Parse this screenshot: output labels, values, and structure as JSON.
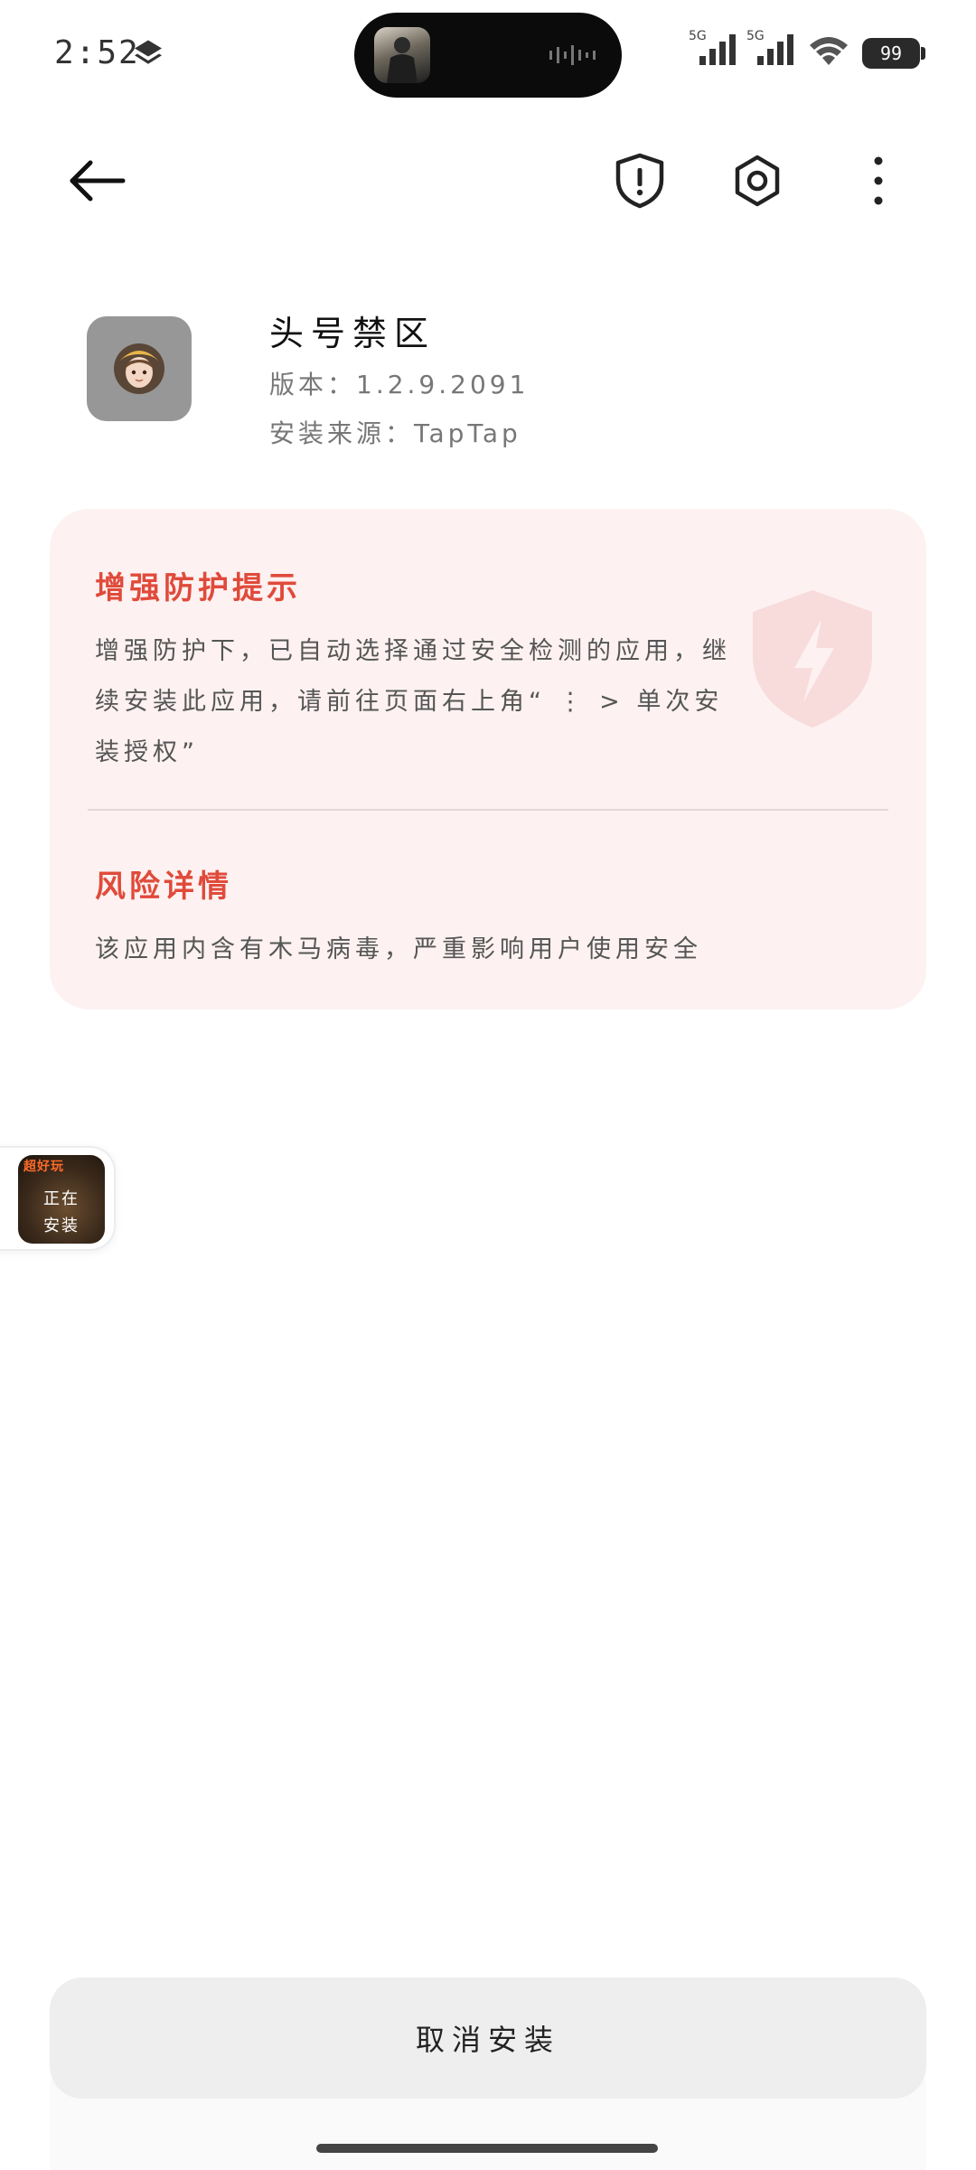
{
  "status_bar": {
    "time": "2:52",
    "network_1": "5G",
    "network_2": "5G",
    "battery": "99"
  },
  "header": {
    "icons": [
      "back-arrow-icon",
      "shield-alert-icon",
      "settings-icon",
      "more-vertical-icon"
    ]
  },
  "app": {
    "name": "头号禁区",
    "version": "版本：1.2.9.2091",
    "source": "安装来源：TapTap"
  },
  "warning_card": {
    "title": "增强防护提示",
    "text": "增强防护下，已自动选择通过安全检测的应用，继续安装此应用，请前往页面右上角“ ⋮ > 单次安装授权”",
    "risk_title": "风险详情",
    "risk_text": "该应用内含有木马病毒，严重影响用户使用安全",
    "accent_color": "#e04a3a",
    "background_color": "#fdf1f1"
  },
  "floating_bubble": {
    "badge": "超好玩",
    "line1": "正在",
    "line2": "安装"
  },
  "cancel_button": "取消安装"
}
